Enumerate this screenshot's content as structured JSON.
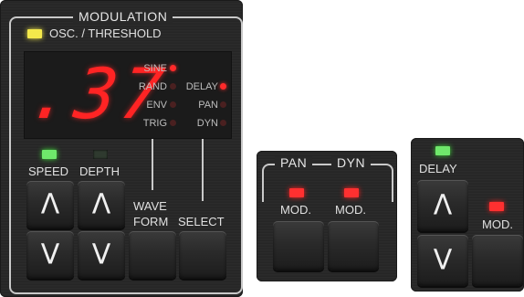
{
  "modulation": {
    "title": "MODULATION",
    "osc_threshold_label": "OSC. / THRESHOLD",
    "display_value": ".37",
    "waveforms": [
      {
        "label": "SINE",
        "active": true
      },
      {
        "label": "RAND",
        "active": false
      },
      {
        "label": "ENV",
        "active": false
      },
      {
        "label": "TRIG",
        "active": false
      }
    ],
    "destinations": [
      {
        "label": "DELAY",
        "active": true
      },
      {
        "label": "PAN",
        "active": false
      },
      {
        "label": "DYN",
        "active": false
      }
    ],
    "speed_label": "SPEED",
    "depth_label": "DEPTH",
    "waveform_label_1": "WAVE",
    "waveform_label_2": "FORM",
    "select_label": "SELECT",
    "up_glyph": "Λ",
    "down_glyph": "V"
  },
  "pan_dyn": {
    "pan_label": "PAN",
    "dyn_label": "DYN",
    "pan_mod_label": "MOD.",
    "dyn_mod_label": "MOD."
  },
  "delay": {
    "label": "DELAY",
    "mod_label": "MOD.",
    "up_glyph": "Λ",
    "down_glyph": "V"
  },
  "colors": {
    "led_red": "#ff3030",
    "led_green": "#6fe86b",
    "led_yellow": "#f4e94b"
  }
}
